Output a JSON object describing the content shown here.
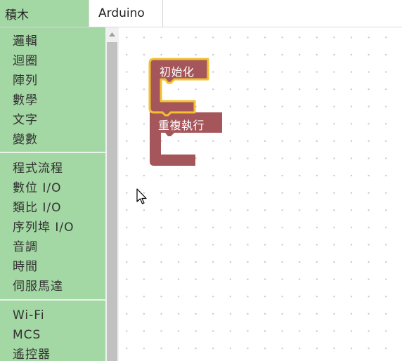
{
  "tabs": {
    "blocks": "積木",
    "arduino": "Arduino"
  },
  "toolbox": {
    "group1": [
      "邏輯",
      "迴圈",
      "陣列",
      "數學",
      "文字",
      "變數"
    ],
    "group2": [
      "程式流程",
      "數位 I/O",
      "類比 I/O",
      "序列埠 I/O",
      "音調",
      "時間",
      "伺服馬達"
    ],
    "group3": [
      "Wi-Fi",
      "MCS",
      "遙控器"
    ]
  },
  "workspace": {
    "blocks": {
      "setup_label": "初始化",
      "loop_label": "重複執行"
    }
  },
  "colors": {
    "toolbox_bg": "#a3d7a3",
    "block_fill": "#a5565a",
    "block_highlight": "#f2c12e"
  },
  "icons": {
    "scroll_up": "triangle-up-icon",
    "cursor": "mouse-pointer-icon"
  }
}
